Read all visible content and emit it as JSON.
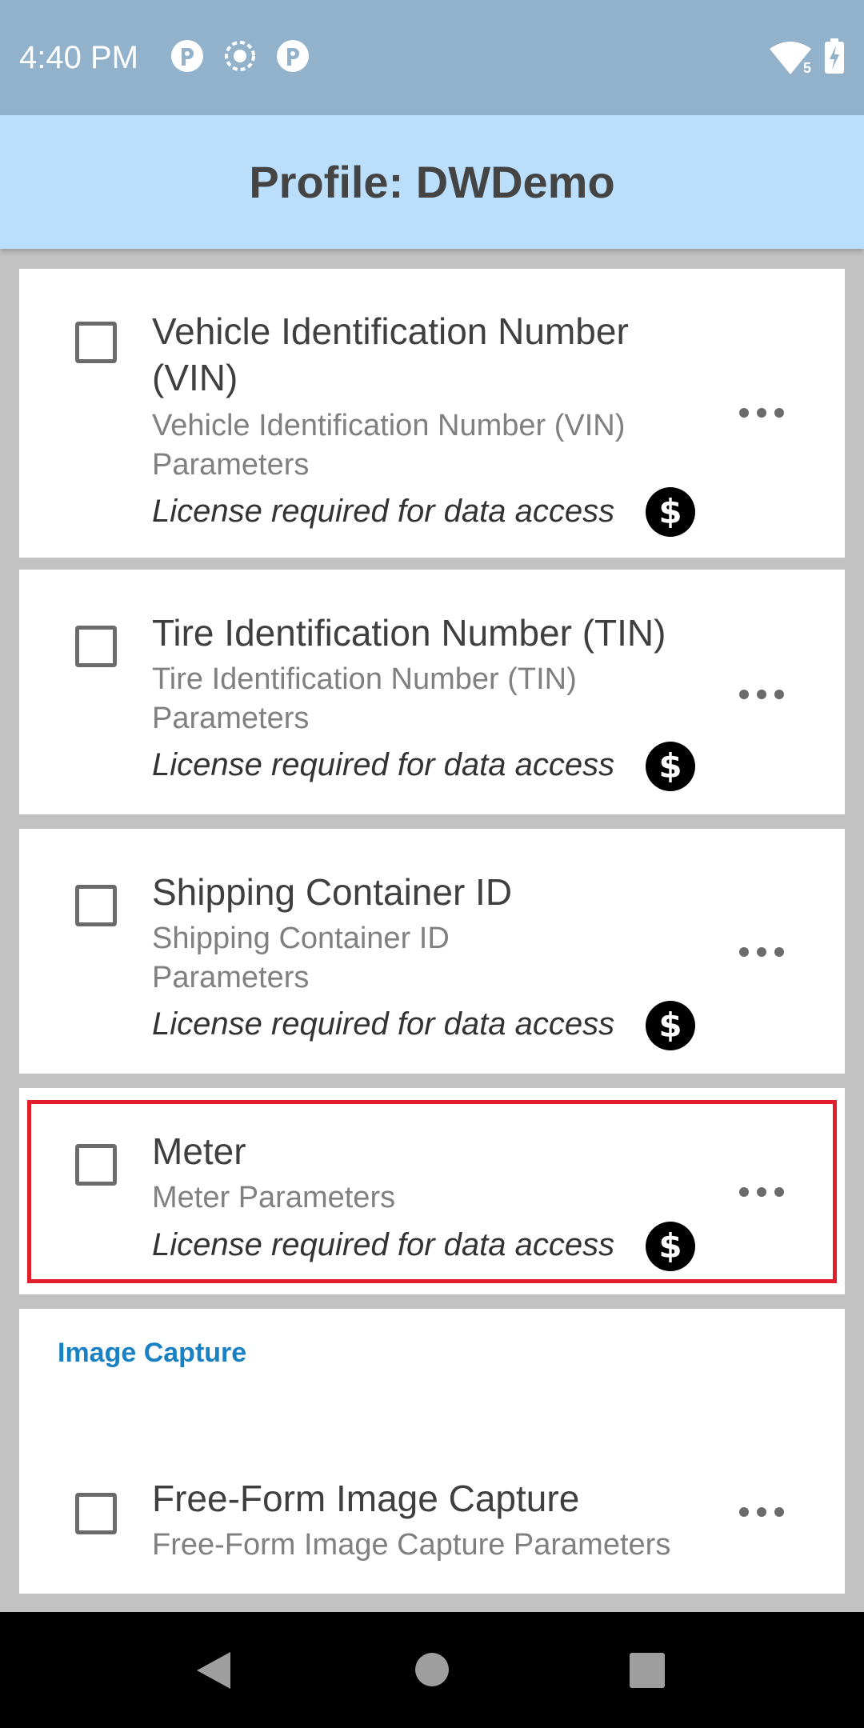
{
  "status_bar": {
    "time": "4:40 PM",
    "icons": [
      "app-notification-icon",
      "screen-record-icon",
      "app-notification-icon",
      "wifi-icon",
      "battery-charging-icon"
    ],
    "wifi_badge": "5"
  },
  "app_bar": {
    "title": "Profile: DWDemo"
  },
  "items": [
    {
      "title": "Vehicle Identification Number (VIN)",
      "subtitle": "Vehicle Identification Number (VIN) Parameters",
      "license": "License required for data access",
      "checked": false
    },
    {
      "title": "Tire Identification Number (TIN)",
      "subtitle": "Tire Identification Number (TIN) Parameters",
      "license": "License required for data access",
      "checked": false
    },
    {
      "title": "Shipping Container ID",
      "subtitle": "Shipping Container ID Parameters",
      "license": "License required for data access",
      "checked": false
    },
    {
      "title": "Meter",
      "subtitle": "Meter Parameters",
      "license": "License required for data access",
      "checked": false,
      "highlighted": true
    }
  ],
  "section": {
    "header": "Image Capture",
    "items": [
      {
        "title": "Free-Form Image Capture",
        "subtitle": "Free-Form Image Capture Parameters",
        "checked": false
      }
    ]
  },
  "colors": {
    "status_bar": "#92b1ca",
    "app_bar": "#bbdefb",
    "section_header": "#1a80c4",
    "highlight": "#e01f2b"
  }
}
